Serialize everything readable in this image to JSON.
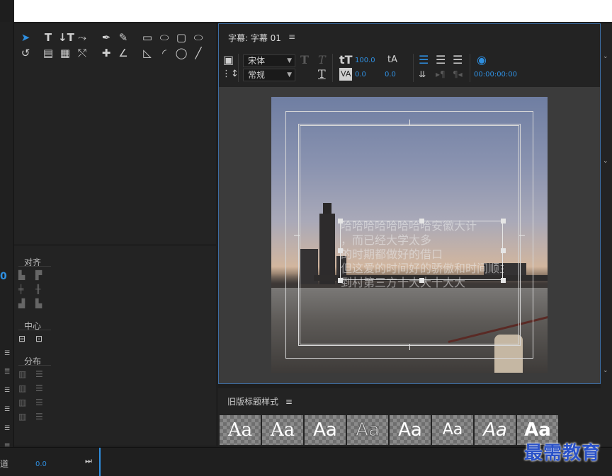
{
  "titler": {
    "tab_label": "字幕: 字幕 01",
    "menu_icon": "≡",
    "font_family": "宋体",
    "font_style": "常规",
    "font_size": "100.0",
    "kerning": "0.0",
    "leading": "0.0",
    "timecode": "00:00:00:00",
    "caption_lines": [
      "哈哈哈哈哈哈哈哈安徽大计",
      "，而已经大学太多",
      "的时期都做好的借口",
      "但这爱的时间好的骄傲和时间顺主",
      "到村第三方十大大十大大"
    ]
  },
  "align_panel": {
    "align_title": "对齐",
    "center_title": "中心",
    "distribute_title": "分布"
  },
  "styles_panel": {
    "label": "旧版标题样式",
    "menu_icon": "≡",
    "swatches": [
      "Aa",
      "Aa",
      "Aa",
      "Aa",
      "Aa",
      "Aa",
      "Aa",
      "Aa"
    ]
  },
  "timeline": {
    "track_label": "道",
    "value": "0.0"
  },
  "left_strip": {
    "value": "0"
  },
  "watermark": "最需教育",
  "colors": {
    "accent": "#2f8fe0",
    "panel": "#232323",
    "border_active": "#3d6fa6"
  }
}
